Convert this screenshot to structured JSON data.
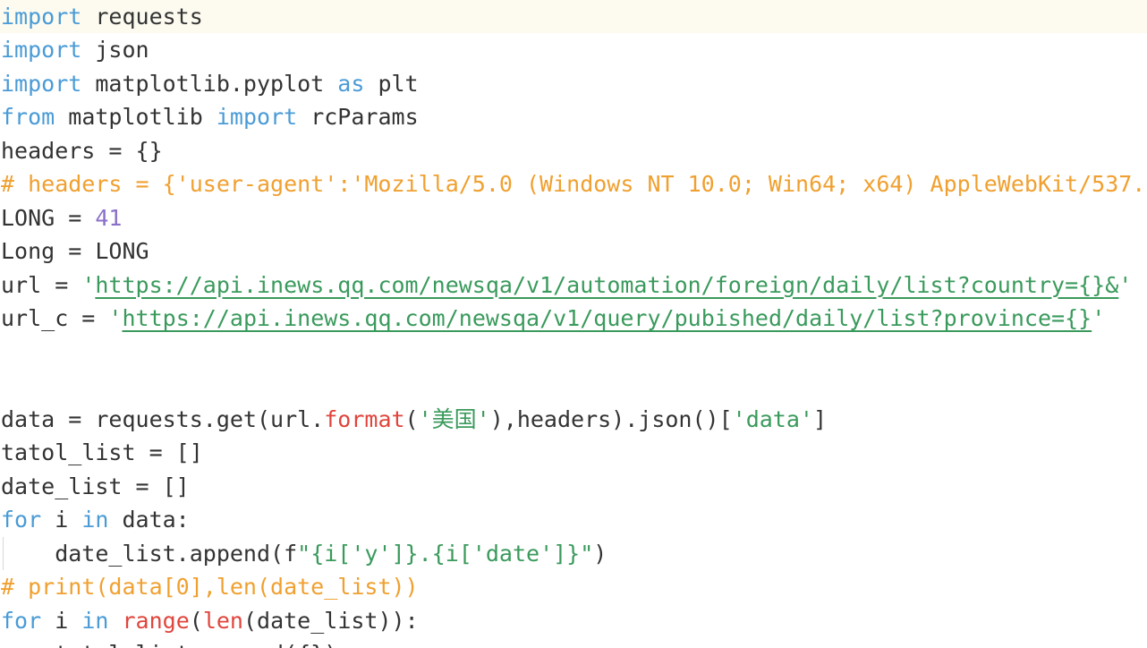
{
  "editor": {
    "colors": {
      "keyword": "#4a9bd6",
      "string": "#3a9a5c",
      "comment": "#f0a030",
      "number": "#8a70c8",
      "builtin": "#e0453c",
      "text": "#333333",
      "active_line": "#fdfbf0"
    },
    "lines": [
      {
        "active": true,
        "tokens": [
          {
            "t": "import",
            "c": "kw"
          },
          {
            "t": " requests"
          }
        ]
      },
      {
        "tokens": [
          {
            "t": "import",
            "c": "kw"
          },
          {
            "t": " json"
          }
        ]
      },
      {
        "tokens": [
          {
            "t": "import",
            "c": "kw"
          },
          {
            "t": " matplotlib.pyplot "
          },
          {
            "t": "as",
            "c": "kw"
          },
          {
            "t": " plt"
          }
        ]
      },
      {
        "tokens": [
          {
            "t": "from",
            "c": "kw"
          },
          {
            "t": " matplotlib "
          },
          {
            "t": "import",
            "c": "kw"
          },
          {
            "t": " rcParams"
          }
        ]
      },
      {
        "tokens": [
          {
            "t": "headers = {}"
          }
        ]
      },
      {
        "tokens": [
          {
            "t": "# headers = {'user-agent':'Mozilla/5.0 (Windows NT 10.0; Win64; x64) AppleWebKit/537.",
            "c": "cmt"
          }
        ]
      },
      {
        "tokens": [
          {
            "t": "LONG = "
          },
          {
            "t": "41",
            "c": "num"
          }
        ]
      },
      {
        "tokens": [
          {
            "t": "Long = LONG"
          }
        ]
      },
      {
        "tokens": [
          {
            "t": "url = "
          },
          {
            "t": "'",
            "c": "str"
          },
          {
            "t": "https://api.inews.qq.com/newsqa/v1/automation/foreign/daily/list?country={}&",
            "c": "str url"
          },
          {
            "t": "'",
            "c": "str"
          }
        ]
      },
      {
        "tokens": [
          {
            "t": "url_c = "
          },
          {
            "t": "'",
            "c": "str"
          },
          {
            "t": "https://api.inews.qq.com/newsqa/v1/query/pubished/daily/list?province={}",
            "c": "str url"
          },
          {
            "t": "'",
            "c": "str"
          }
        ]
      },
      {
        "tokens": []
      },
      {
        "tokens": []
      },
      {
        "tokens": [
          {
            "t": "data = requests.get(url."
          },
          {
            "t": "format",
            "c": "fn"
          },
          {
            "t": "("
          },
          {
            "t": "'美国'",
            "c": "str"
          },
          {
            "t": "),headers).json()["
          },
          {
            "t": "'data'",
            "c": "str"
          },
          {
            "t": "]"
          }
        ]
      },
      {
        "tokens": [
          {
            "t": "tatol_list = []"
          }
        ]
      },
      {
        "tokens": [
          {
            "t": "date_list = []"
          }
        ]
      },
      {
        "tokens": [
          {
            "t": "for",
            "c": "kw"
          },
          {
            "t": " i "
          },
          {
            "t": "in",
            "c": "kw"
          },
          {
            "t": " data:"
          }
        ]
      },
      {
        "indent": true,
        "tokens": [
          {
            "t": "    date_list.append(f"
          },
          {
            "t": "\"{i['y']}.{i['date']}\"",
            "c": "str"
          },
          {
            "t": ")"
          }
        ]
      },
      {
        "tokens": [
          {
            "t": "# print(data[0],len(date_list))",
            "c": "cmt"
          }
        ]
      },
      {
        "tokens": [
          {
            "t": "for",
            "c": "kw"
          },
          {
            "t": " i "
          },
          {
            "t": "in",
            "c": "kw"
          },
          {
            "t": " "
          },
          {
            "t": "range",
            "c": "fn"
          },
          {
            "t": "("
          },
          {
            "t": "len",
            "c": "fn"
          },
          {
            "t": "(date_list)):"
          }
        ]
      },
      {
        "tokens": [
          {
            "t": "    tatol_list.append({})"
          }
        ]
      }
    ]
  }
}
